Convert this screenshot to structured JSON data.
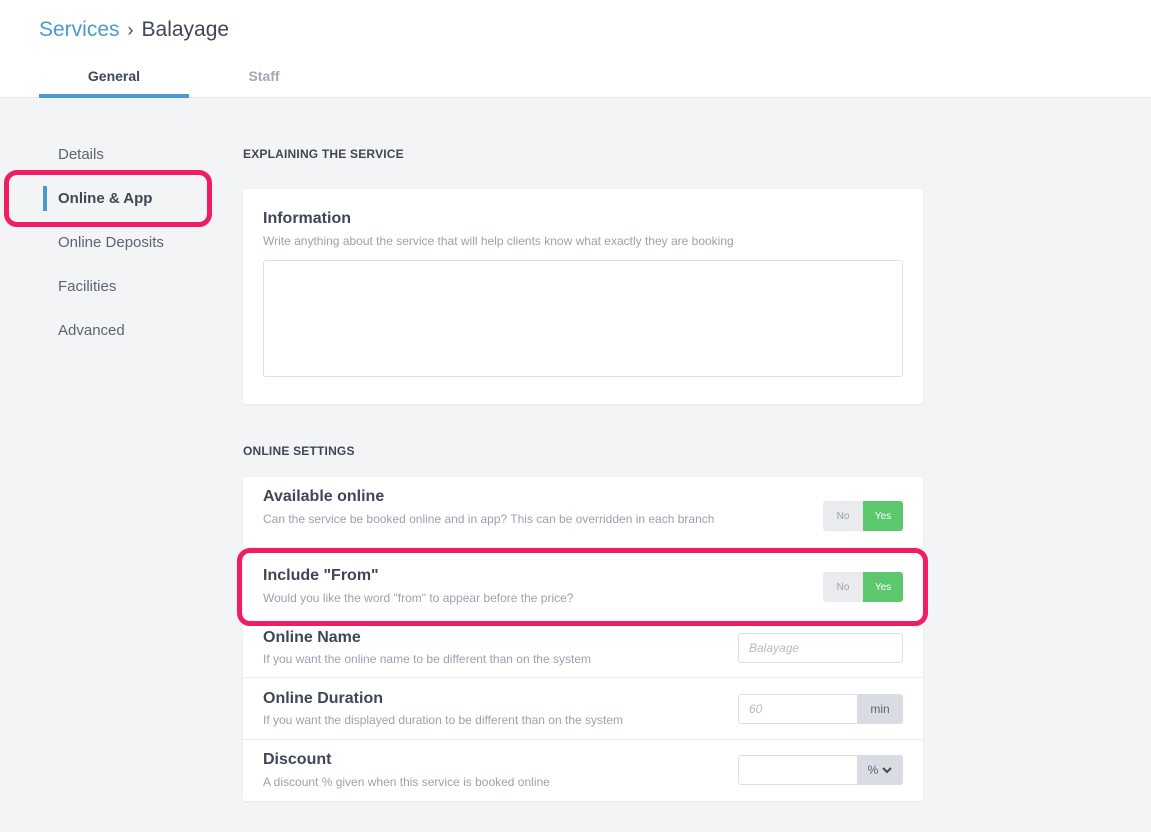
{
  "breadcrumb": {
    "parent": "Services",
    "separator": "›",
    "current": "Balayage"
  },
  "tabs": {
    "general": "General",
    "staff": "Staff"
  },
  "sidebar": {
    "items": [
      {
        "label": "Details"
      },
      {
        "label": "Online & App"
      },
      {
        "label": "Online Deposits"
      },
      {
        "label": "Facilities"
      },
      {
        "label": "Advanced"
      }
    ]
  },
  "explaining": {
    "section_title": "EXPLAINING THE SERVICE",
    "title": "Information",
    "desc": "Write anything about the service that will help clients know what exactly they are booking",
    "value": ""
  },
  "online": {
    "section_title": "ONLINE SETTINGS",
    "available": {
      "title": "Available online",
      "desc": "Can the service be booked online and in app? This can be overridden in each branch",
      "no": "No",
      "yes": "Yes"
    },
    "include_from": {
      "title": "Include \"From\"",
      "desc": "Would you like the word \"from\" to appear before the price?",
      "no": "No",
      "yes": "Yes"
    },
    "online_name": {
      "title": "Online Name",
      "desc": "If you want the online name to be different than on the system",
      "placeholder": "Balayage"
    },
    "online_duration": {
      "title": "Online Duration",
      "desc": "If you want the displayed duration to be different than on the system",
      "placeholder": "60",
      "unit": "min"
    },
    "discount": {
      "title": "Discount",
      "desc": "A discount % given when this service is booked online",
      "value": "",
      "unit": "%"
    }
  },
  "colors": {
    "accent": "#4a9ad0",
    "highlight": "#f01d62",
    "yes": "#5cc76c"
  }
}
